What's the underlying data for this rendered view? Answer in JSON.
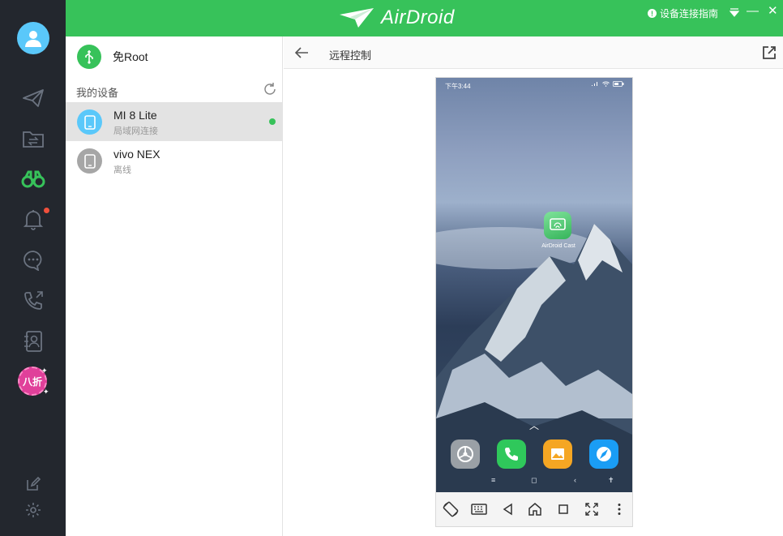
{
  "app": {
    "name": "AirDroid"
  },
  "header": {
    "guide_label": "设备连接指南",
    "minimize_glyph": "—",
    "close_glyph": "✕"
  },
  "sidebar": {
    "promo_label": "八折",
    "items": [
      {
        "icon": "send-icon"
      },
      {
        "icon": "folder-transfer-icon"
      },
      {
        "icon": "binoculars-icon",
        "active": true
      },
      {
        "icon": "bell-icon",
        "badge": true
      },
      {
        "icon": "chat-icon"
      },
      {
        "icon": "call-icon"
      },
      {
        "icon": "contacts-icon"
      }
    ],
    "bottom": [
      {
        "icon": "edit-icon"
      },
      {
        "icon": "gear-icon"
      }
    ]
  },
  "devices_panel": {
    "noroot_label": "免Root",
    "section_title": "我的设备",
    "devices": [
      {
        "name": "MI 8 Lite",
        "status": "局域网连接",
        "selected": true,
        "online": true
      },
      {
        "name": "vivo NEX",
        "status": "离线",
        "selected": false,
        "online": false
      }
    ]
  },
  "remote": {
    "title": "远程控制",
    "phone": {
      "time": "下午3:44",
      "app_label": "AirDroid Cast"
    }
  },
  "colors": {
    "brand_green": "#37c25a",
    "rail_bg": "#23272e",
    "promo_pink": "#e0409a",
    "notify_red": "#f0503c"
  }
}
